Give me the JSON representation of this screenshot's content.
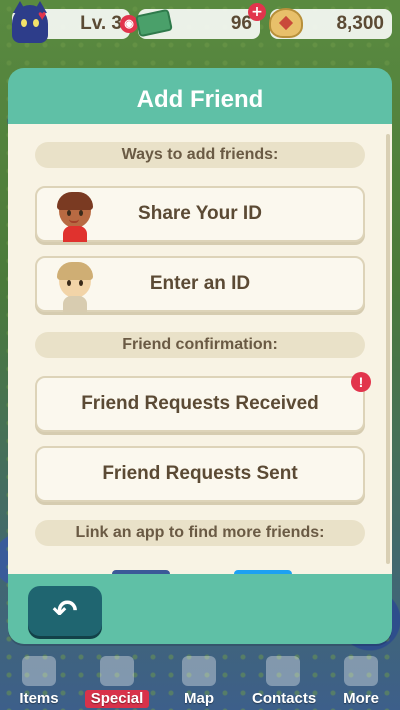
{
  "status_bar": {
    "level_text": "Lv. 3",
    "tickets_value": "96",
    "bells_value": "8,300"
  },
  "modal": {
    "title": "Add Friend",
    "section_ways": "Ways to add friends:",
    "share_id_label": "Share Your ID",
    "enter_id_label": "Enter an ID",
    "section_confirmation": "Friend confirmation:",
    "requests_received_label": "Friend Requests Received",
    "requests_received_alert": "!",
    "requests_sent_label": "Friend Requests Sent",
    "section_link_app": "Link an app to find more friends:"
  },
  "bottom_nav": {
    "items": [
      {
        "label": "Items",
        "icon": "backpack-icon"
      },
      {
        "label": "Special",
        "icon": "pencil-icon",
        "active": true
      },
      {
        "label": "Map",
        "icon": "map-icon"
      },
      {
        "label": "Contacts",
        "icon": "cat-icon"
      },
      {
        "label": "More",
        "icon": "grid-icon"
      }
    ]
  },
  "colors": {
    "modal_green": "#5fc0a6",
    "panel_cream": "#f8f3e4",
    "back_button": "#1f6570",
    "alert_red": "#e2344c",
    "active_tab": "#d8324a"
  }
}
